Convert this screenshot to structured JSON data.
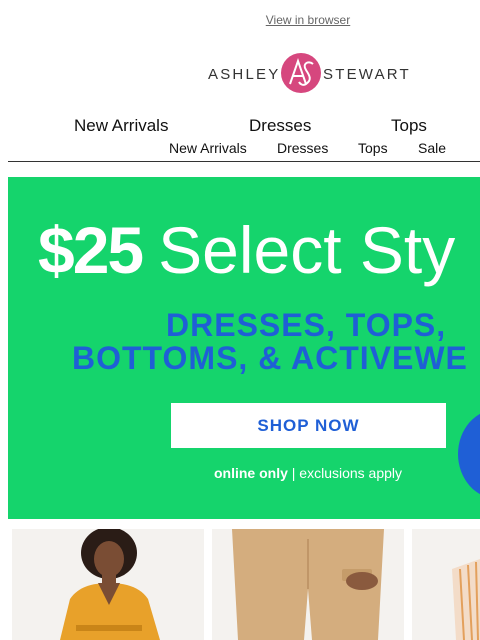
{
  "header": {
    "view_in_browser": "View in browser"
  },
  "logo": {
    "word1": "ASHLEY",
    "word2": "STEWART",
    "monogram": "AS",
    "color": "#d6477e"
  },
  "nav_primary": [
    "New Arrivals",
    "Dresses",
    "Tops"
  ],
  "nav_secondary": [
    "New Arrivals",
    "Dresses",
    "Tops",
    "Sale"
  ],
  "banner": {
    "price": "$25",
    "headline_rest": "Select Sty",
    "line1": "DRESSES, TOPS,",
    "line2": "BOTTOMS, & ACTIVEWE",
    "cta": "SHOP NOW",
    "note_bold": "online only",
    "note_rest": " | exclusions apply",
    "bg_color": "#15d46c",
    "accent_color": "#1f5fd6"
  },
  "tiles": [
    "orange-dress-photo",
    "tan-pants-photo",
    "striped-top-photo"
  ]
}
